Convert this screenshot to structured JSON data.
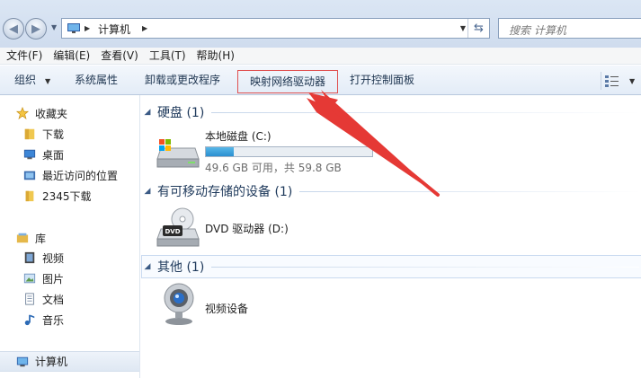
{
  "address": {
    "path": "计算机"
  },
  "search": {
    "placeholder": "搜索 计算机"
  },
  "menu": {
    "items": [
      "文件(F)",
      "编辑(E)",
      "查看(V)",
      "工具(T)",
      "帮助(H)"
    ]
  },
  "toolbar": {
    "organize": "组织",
    "system_properties": "系统属性",
    "uninstall": "卸载或更改程序",
    "map_drive": "映射网络驱动器",
    "control_panel": "打开控制面板"
  },
  "nav": {
    "favorites": "收藏夹",
    "downloads": "下载",
    "desktop": "桌面",
    "recent": "最近访问的位置",
    "downloads2345": "2345下载",
    "libraries": "库",
    "videos": "视频",
    "pictures": "图片",
    "documents": "文档",
    "music": "音乐",
    "computer": "计算机"
  },
  "groups": {
    "hdd": {
      "title": "硬盘 (1)"
    },
    "removable": {
      "title": "有可移动存储的设备 (1)"
    },
    "other": {
      "title": "其他 (1)"
    }
  },
  "drives": {
    "c": {
      "name": "本地磁盘 (C:)",
      "info": "49.6 GB 可用，共 59.8 GB",
      "used_fraction": 0.17
    },
    "d": {
      "name": "DVD 驱动器 (D:)"
    },
    "webcam": {
      "name": "视频设备"
    }
  },
  "colors": {
    "annotation": "#e53935",
    "usage_bar": "#2a8fd0"
  }
}
